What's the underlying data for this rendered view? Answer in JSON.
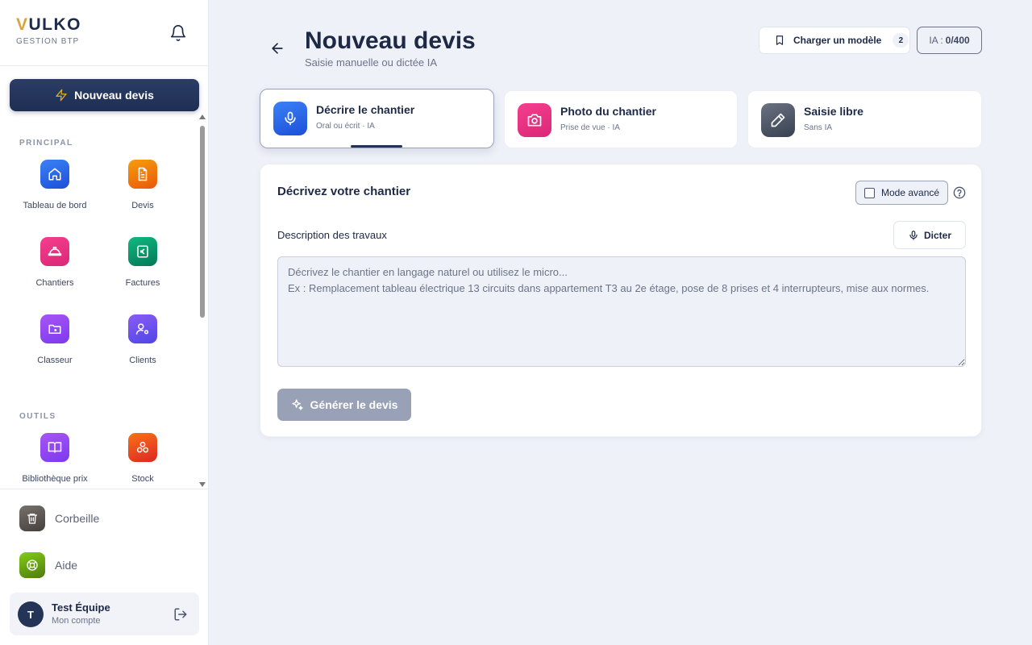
{
  "brand": {
    "logo_first": "V",
    "logo_rest": "ULKO",
    "subtitle": "GESTION BTP"
  },
  "sidebar": {
    "new_quote_label": "Nouveau devis",
    "sections": {
      "principal": "PRINCIPAL",
      "outils": "OUTILS"
    },
    "principal_items": [
      {
        "label": "Tableau de bord",
        "icon": "home-icon"
      },
      {
        "label": "Devis",
        "icon": "document-icon"
      },
      {
        "label": "Chantiers",
        "icon": "hard-hat-icon"
      },
      {
        "label": "Factures",
        "icon": "euro-icon"
      },
      {
        "label": "Classeur",
        "icon": "folder-icon"
      },
      {
        "label": "Clients",
        "icon": "user-settings-icon"
      }
    ],
    "tools_items": [
      {
        "label": "Bibliothèque prix",
        "icon": "book-icon"
      },
      {
        "label": "Stock",
        "icon": "boxes-icon"
      }
    ],
    "bottom_items": [
      {
        "label": "Corbeille",
        "icon": "trash-icon"
      },
      {
        "label": "Aide",
        "icon": "lifebuoy-icon"
      }
    ],
    "account": {
      "initial": "T",
      "name": "Test Équipe",
      "subtitle": "Mon compte"
    }
  },
  "header": {
    "title": "Nouveau devis",
    "subtitle": "Saisie manuelle ou dictée IA",
    "load_model_label": "Charger un modèle",
    "load_model_count": "2",
    "ia_quota_prefix": "IA :",
    "ia_quota_value": "0/400"
  },
  "modes": [
    {
      "title": "Décrire le chantier",
      "subtitle": "Oral ou écrit · IA",
      "icon": "microphone-icon",
      "active": true
    },
    {
      "title": "Photo du chantier",
      "subtitle": "Prise de vue · IA",
      "icon": "camera-icon",
      "active": false
    },
    {
      "title": "Saisie libre",
      "subtitle": "Sans IA",
      "icon": "pencil-icon",
      "active": false
    }
  ],
  "panel": {
    "title": "Décrivez votre chantier",
    "advanced_mode_label": "Mode avancé",
    "advanced_mode_checked": false,
    "field_label": "Description des travaux",
    "dictate_label": "Dicter",
    "input_value": "",
    "input_placeholder": "Décrivez le chantier en langage naturel ou utilisez le micro...\nEx : Remplacement tableau électrique 13 circuits dans appartement T3 au 2e étage, pose de 8 prises et 4 interrupteurs, mise aux normes.",
    "generate_label": "Générer le devis"
  },
  "colors": {
    "navy": "#1d2945",
    "accent_gold": "#d9a33a",
    "background": "#eef1f8",
    "disabled_button": "#98a1b5"
  }
}
